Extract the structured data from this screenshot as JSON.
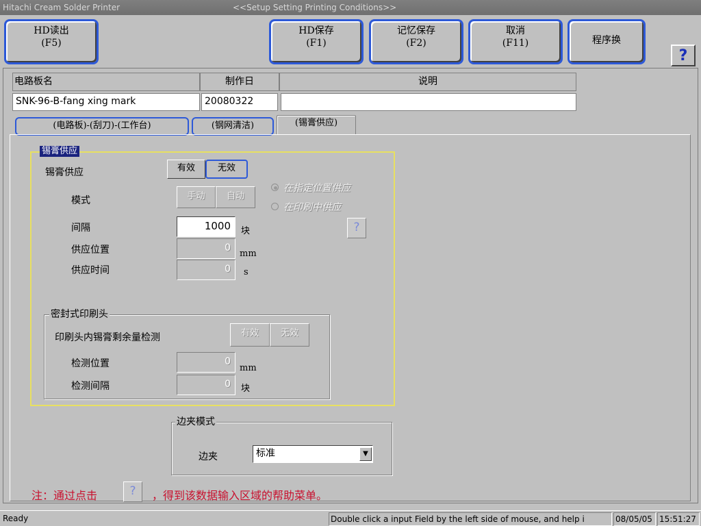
{
  "window": {
    "app_title": "Hitachi Cream Solder Printer",
    "screen_title": "<<Setup Setting Printing Conditions>>"
  },
  "toolbar": {
    "hd_read": {
      "line1": "HD读出",
      "line2": "(F5)"
    },
    "hd_save": {
      "line1": "HD保存",
      "line2": "(F1)"
    },
    "memory_save": {
      "line1": "记忆保存",
      "line2": "(F2)"
    },
    "cancel": {
      "line1": "取消",
      "line2": "(F11)"
    },
    "program_change": "程序换",
    "help": "?"
  },
  "board_info": {
    "name_header": "电路板名",
    "date_header": "制作日",
    "desc_header": "说明",
    "name_value": "SNK-96-B-fang xing mark",
    "date_value": "20080322",
    "desc_value": ""
  },
  "tabs": [
    {
      "label": "(电路板)-(刮刀)-(工作台)"
    },
    {
      "label": "(钢网清洁)"
    },
    {
      "label": "(锡膏供应)"
    }
  ],
  "solder_supply": {
    "group_title": "锡膏供应",
    "supply_label": "锡膏供应",
    "enable": "有效",
    "disable": "无效",
    "mode_label": "模式",
    "mode_manual": "手动",
    "mode_auto": "自动",
    "radio_fixed_position": "在指定位置供应",
    "radio_during_print": "在印刷中供应",
    "interval_label": "间隔",
    "interval_value": "1000",
    "interval_unit": "块",
    "position_label": "供应位置",
    "position_value": "0",
    "position_unit": "mm",
    "time_label": "供应时间",
    "time_value": "0",
    "time_unit": "s",
    "help": "?"
  },
  "sealed_head": {
    "title": "密封式印刷头",
    "remaining_label": "印刷头内锡膏剩余量检测",
    "enable": "有效",
    "disable": "无效",
    "detect_pos_label": "检测位置",
    "detect_pos_value": "0",
    "detect_pos_unit": "mm",
    "detect_interval_label": "检测间隔",
    "detect_interval_value": "0",
    "detect_interval_unit": "块"
  },
  "edge_mode": {
    "title": "边夹模式",
    "label": "边夹",
    "selected": "标准"
  },
  "note": {
    "prefix": "注：通过点击",
    "help": "?",
    "suffix": "，得到该数据输入区域的帮助菜单。"
  },
  "status": {
    "state": "Ready",
    "hint": "Double click a input Field by the left side of mouse, and help i",
    "date": "08/05/05",
    "time": "15:51:27"
  },
  "colors": {
    "accent_blue": "#2d59d8",
    "group_label_bg": "#1a237e",
    "highlight_yellow": "#e8e060",
    "note_red": "#c8102e"
  }
}
